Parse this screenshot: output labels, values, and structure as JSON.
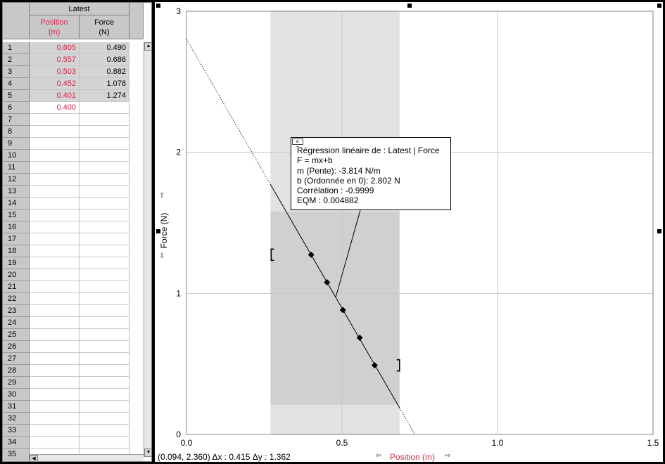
{
  "table": {
    "group_title": "Latest",
    "columns": [
      {
        "name": "Position",
        "unit": "(m)",
        "color": "#d02848"
      },
      {
        "name": "Force",
        "unit": "(N)",
        "color": "#000000"
      }
    ],
    "rows": [
      {
        "n": "1",
        "position": "0.605",
        "force": "0.490"
      },
      {
        "n": "2",
        "position": "0.557",
        "force": "0.686"
      },
      {
        "n": "3",
        "position": "0.503",
        "force": "0.882"
      },
      {
        "n": "4",
        "position": "0.452",
        "force": "1.078"
      },
      {
        "n": "5",
        "position": "0.401",
        "force": "1.274"
      },
      {
        "n": "6",
        "position": "0.400",
        "force": ""
      },
      {
        "n": "7",
        "position": "",
        "force": ""
      },
      {
        "n": "8",
        "position": "",
        "force": ""
      },
      {
        "n": "9",
        "position": "",
        "force": ""
      },
      {
        "n": "10",
        "position": "",
        "force": ""
      },
      {
        "n": "11",
        "position": "",
        "force": ""
      },
      {
        "n": "12",
        "position": "",
        "force": ""
      },
      {
        "n": "13",
        "position": "",
        "force": ""
      },
      {
        "n": "14",
        "position": "",
        "force": ""
      },
      {
        "n": "15",
        "position": "",
        "force": ""
      },
      {
        "n": "16",
        "position": "",
        "force": ""
      },
      {
        "n": "17",
        "position": "",
        "force": ""
      },
      {
        "n": "18",
        "position": "",
        "force": ""
      },
      {
        "n": "19",
        "position": "",
        "force": ""
      },
      {
        "n": "20",
        "position": "",
        "force": ""
      },
      {
        "n": "21",
        "position": "",
        "force": ""
      },
      {
        "n": "22",
        "position": "",
        "force": ""
      },
      {
        "n": "23",
        "position": "",
        "force": ""
      },
      {
        "n": "24",
        "position": "",
        "force": ""
      },
      {
        "n": "25",
        "position": "",
        "force": ""
      },
      {
        "n": "26",
        "position": "",
        "force": ""
      },
      {
        "n": "27",
        "position": "",
        "force": ""
      },
      {
        "n": "28",
        "position": "",
        "force": ""
      },
      {
        "n": "29",
        "position": "",
        "force": ""
      },
      {
        "n": "30",
        "position": "",
        "force": ""
      },
      {
        "n": "31",
        "position": "",
        "force": ""
      },
      {
        "n": "32",
        "position": "",
        "force": ""
      },
      {
        "n": "33",
        "position": "",
        "force": ""
      },
      {
        "n": "34",
        "position": "",
        "force": ""
      },
      {
        "n": "35",
        "position": "",
        "force": ""
      }
    ]
  },
  "graph": {
    "y_axis_label": "Force (N)",
    "x_axis_label": "Position (m)",
    "status_text": "(0.094, 2.360) Δx : 0.415 Δy : 1.362",
    "close_glyph": "× −",
    "arrow_up": "⇧",
    "arrow_down": "⇩",
    "arrow_left": "⇦",
    "arrow_right": "⇨",
    "regression": {
      "title": "Régression linéaire de :  Latest | Force",
      "equation": "F = mx+b",
      "slope": "m (Pente): -3.814 N/m",
      "intercept": "b (Ordonnée en 0): 2.802 N",
      "correlation": "Corrélation : -0.9999",
      "rmse": "EQM : 0.004882"
    }
  },
  "chart_data": {
    "type": "scatter",
    "xlabel": "Position (m)",
    "ylabel": "Force (N)",
    "xlim": [
      0,
      1.5
    ],
    "ylim": [
      0,
      3
    ],
    "x_ticks": [
      "0.0",
      "0.5",
      "1.0",
      "1.5"
    ],
    "y_ticks": [
      "0",
      "1",
      "2",
      "3"
    ],
    "grid": true,
    "series": [
      {
        "name": "Latest | Force",
        "x": [
          0.605,
          0.557,
          0.503,
          0.452,
          0.401
        ],
        "y": [
          0.49,
          0.686,
          0.882,
          1.078,
          1.274
        ]
      }
    ],
    "fit": {
      "type": "linear",
      "m": -3.814,
      "b": 2.802,
      "x_range": [
        0.27,
        0.685
      ]
    },
    "selection_x_range": [
      0.27,
      0.685
    ],
    "selection_y_range": [
      0.21,
      1.58
    ],
    "colors": {
      "grid": "#c8c8c8",
      "selection_outer": "#e2e2e2",
      "selection_inner": "#d0d0d0",
      "x_label": "#d02848"
    }
  }
}
